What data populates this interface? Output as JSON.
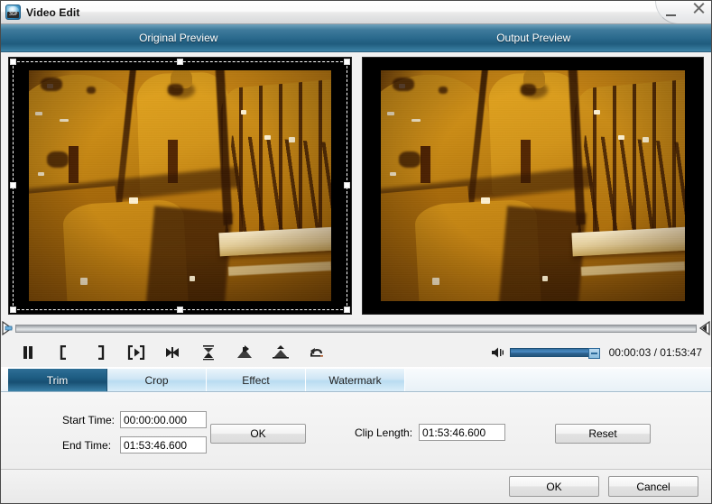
{
  "window": {
    "title": "Video Edit",
    "icon": "video-file-3gp-icon",
    "icon_tag": "3GP",
    "minimize_label": "Minimize",
    "close_label": "Close"
  },
  "previews": {
    "original_label": "Original Preview",
    "output_label": "Output Preview"
  },
  "transport": {
    "buttons": [
      {
        "name": "pause-button",
        "label": "Pause"
      },
      {
        "name": "set-start-button",
        "label": "Set Start Point"
      },
      {
        "name": "set-end-button",
        "label": "Set End Point"
      },
      {
        "name": "play-clip-button",
        "label": "Play Clip"
      },
      {
        "name": "previous-frame-button",
        "label": "Previous Frame"
      },
      {
        "name": "snapshot-button",
        "label": "Snapshot"
      },
      {
        "name": "flip-vertical-button",
        "label": "Flip Vertical"
      },
      {
        "name": "flip-horizontal-button",
        "label": "Flip Horizontal"
      },
      {
        "name": "rotate-button",
        "label": "Rotate"
      }
    ],
    "volume_icon": "speaker-icon",
    "volume_value": 100,
    "time_display": "00:00:03 / 01:53:47",
    "current_time": "00:00:03",
    "total_time": "01:53:47"
  },
  "timeline": {
    "left_marker": "trim-start-marker",
    "right_marker": "trim-end-marker",
    "position_percent": 0
  },
  "tabs": [
    {
      "label": "Trim",
      "active": true
    },
    {
      "label": "Crop",
      "active": false
    },
    {
      "label": "Effect",
      "active": false
    },
    {
      "label": "Watermark",
      "active": false
    }
  ],
  "trim_panel": {
    "start_time_label": "Start Time:",
    "start_time_value": "00:00:00.000",
    "end_time_label": "End Time:",
    "end_time_value": "01:53:46.600",
    "ok_label": "OK",
    "clip_length_label": "Clip Length:",
    "clip_length_value": "01:53:46.600",
    "reset_label": "Reset"
  },
  "footer": {
    "ok_label": "OK",
    "cancel_label": "Cancel"
  },
  "colors": {
    "header_blue": "#2b6a8d",
    "active_tab_blue": "#1d5c82",
    "panel_bg": "#f0f0f0",
    "video_bg": "#000000"
  }
}
